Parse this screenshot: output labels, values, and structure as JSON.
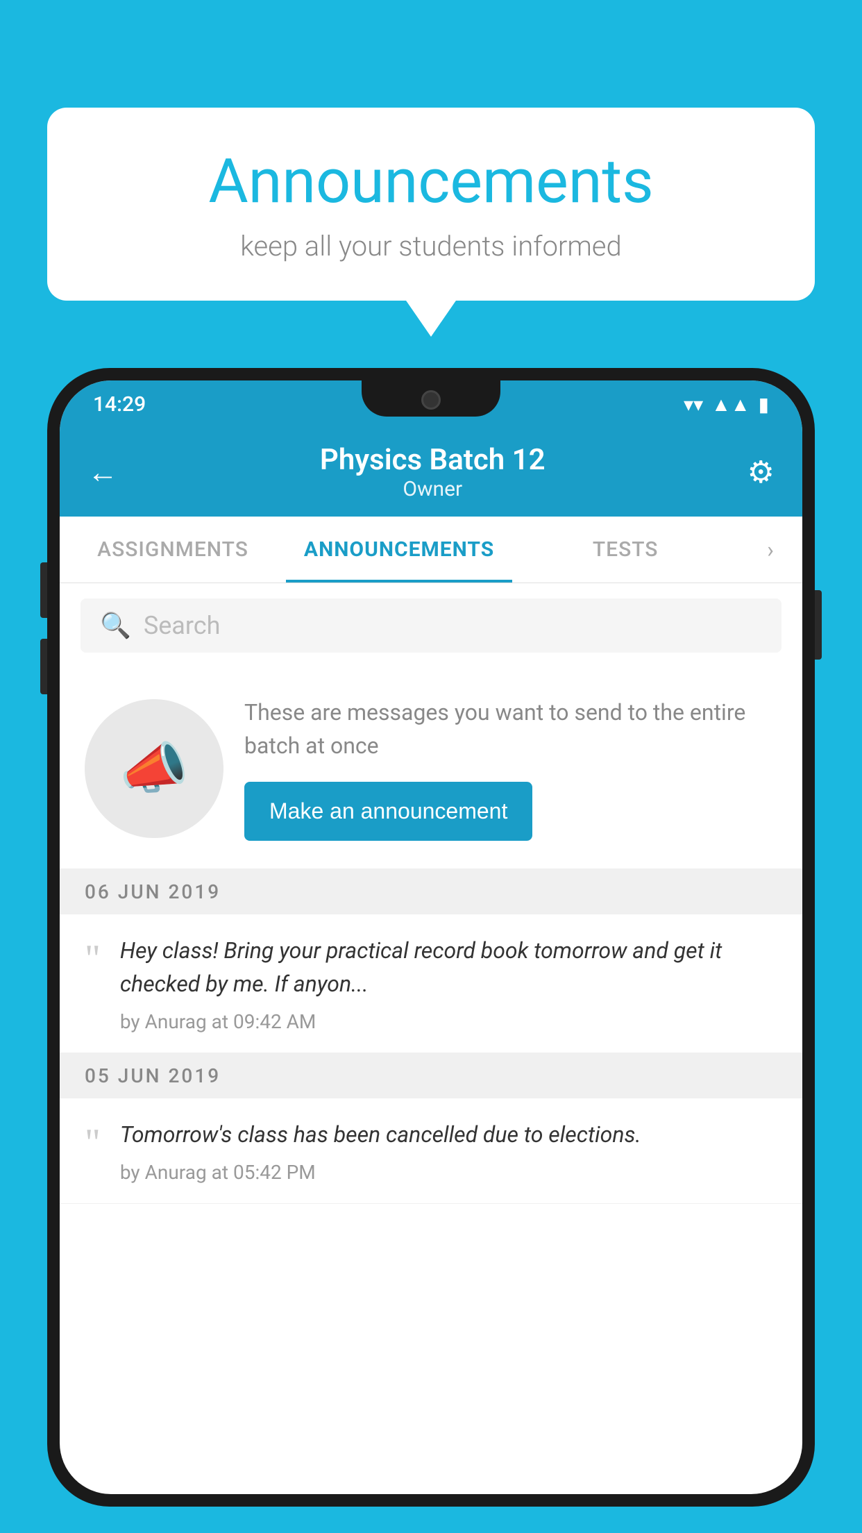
{
  "page": {
    "background_color": "#1bb8e0"
  },
  "speech_bubble": {
    "title": "Announcements",
    "subtitle": "keep all your students informed"
  },
  "status_bar": {
    "time": "14:29",
    "wifi_icon": "▼",
    "signal_icon": "◀",
    "battery_icon": "▮"
  },
  "app_header": {
    "back_label": "←",
    "title": "Physics Batch 12",
    "subtitle": "Owner",
    "gear_label": "⚙"
  },
  "tabs": [
    {
      "label": "ASSIGNMENTS",
      "active": false
    },
    {
      "label": "ANNOUNCEMENTS",
      "active": true
    },
    {
      "label": "TESTS",
      "active": false
    }
  ],
  "search": {
    "placeholder": "Search"
  },
  "announcement_prompt": {
    "description": "These are messages you want to send to the entire batch at once",
    "button_label": "Make an announcement"
  },
  "announcements": [
    {
      "date": "06  JUN  2019",
      "preview": "Hey class! Bring your practical record book tomorrow and get it checked by me. If anyon...",
      "meta": "by Anurag at 09:42 AM"
    },
    {
      "date": "05  JUN  2019",
      "preview": "Tomorrow's class has been cancelled due to elections.",
      "meta": "by Anurag at 05:42 PM"
    }
  ]
}
